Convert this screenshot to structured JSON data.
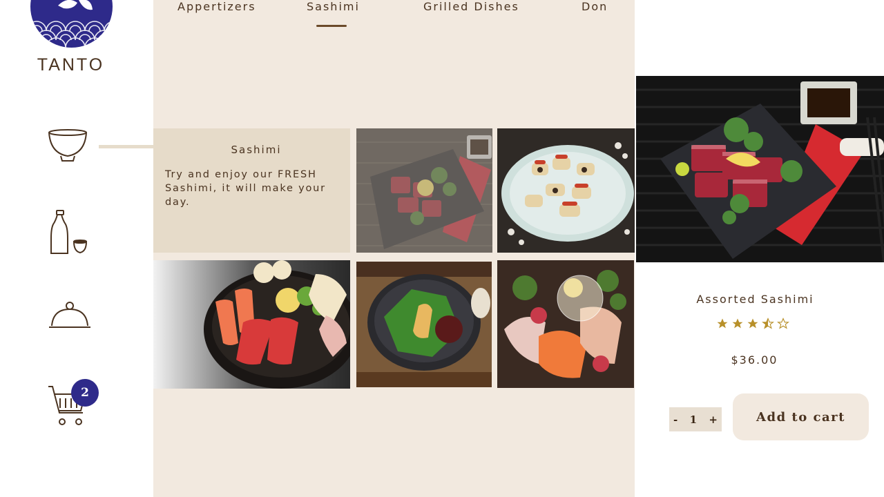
{
  "brand": {
    "name": "TANTO"
  },
  "sidebar": {
    "items": [
      {
        "icon": "bowl-icon"
      },
      {
        "icon": "sake-bottle-icon"
      },
      {
        "icon": "cloche-icon"
      },
      {
        "icon": "cart-icon",
        "badge": "2"
      }
    ]
  },
  "tabs": [
    {
      "label": "Appertizers"
    },
    {
      "label": "Sashimi",
      "active": true
    },
    {
      "label": "Grilled Dishes"
    },
    {
      "label": "Don"
    }
  ],
  "category": {
    "title": "Sashimi",
    "description": "Try and enjoy our FRESH Sashimi, it will make your day."
  },
  "gallery": [
    {
      "dish": "seared-tuna-on-slate"
    },
    {
      "dish": "sushi-roll-platter"
    },
    {
      "dish": "salmon-tuna-sashimi-bowl"
    },
    {
      "dish": "uni-on-shiso-leaf"
    },
    {
      "dish": "sashimi-boat"
    }
  ],
  "product": {
    "name": "Assorted Sashimi",
    "rating": 3.5,
    "rating_max": 5,
    "price": "$36.00",
    "quantity": "1",
    "qty_minus": "-",
    "qty_plus": "+",
    "add_to_cart": "Add to cart"
  },
  "colors": {
    "accent_brown": "#4a3320",
    "panel_beige": "#f2e9df",
    "badge_navy": "#2e2a8a",
    "star_gold": "#b8902a"
  }
}
